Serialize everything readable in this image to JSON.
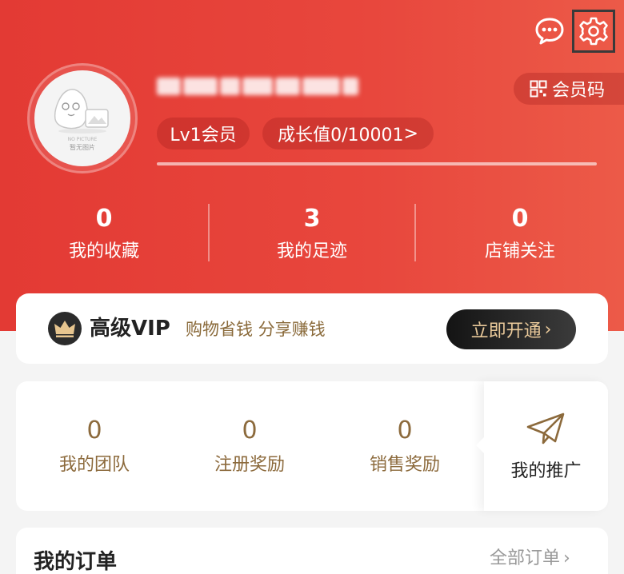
{
  "header": {
    "message_icon": "chat-bubble-icon",
    "settings_icon": "gear-icon"
  },
  "profile": {
    "avatar_caption": "暂无图片",
    "avatar_caption_en": "NO PICTURE",
    "level_label": "Lv1会员",
    "growth_label": "成长值0/10001",
    "growth_arrow": ">",
    "member_code_label": "会员码"
  },
  "stats": [
    {
      "value": "0",
      "label": "我的收藏"
    },
    {
      "value": "3",
      "label": "我的足迹"
    },
    {
      "value": "0",
      "label": "店铺关注"
    }
  ],
  "vip": {
    "title": "高级VIP",
    "subtitle": "购物省钱 分享赚钱",
    "button_label": "立即开通",
    "button_arrow": "›"
  },
  "promotion": {
    "stats": [
      {
        "value": "0",
        "label": "我的团队"
      },
      {
        "value": "0",
        "label": "注册奖励"
      },
      {
        "value": "0",
        "label": "销售奖励"
      }
    ],
    "side_label": "我的推广"
  },
  "orders": {
    "title": "我的订单",
    "all_label": "全部订单",
    "all_arrow": "›"
  },
  "colors": {
    "hero_red": "#e33a34",
    "gold_text": "#8c6a3c",
    "vip_button_text": "#e9c99a"
  }
}
